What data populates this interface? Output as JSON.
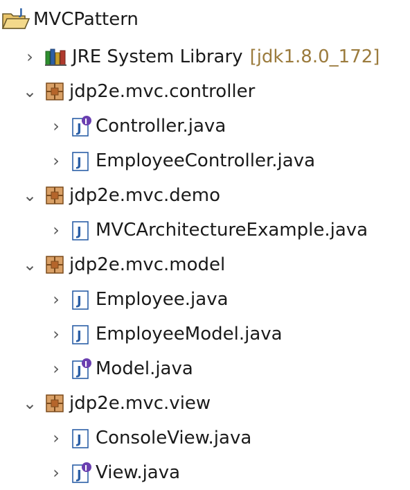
{
  "tree": {
    "project": {
      "label": "MVCPattern",
      "icon": "java-project-icon"
    },
    "jre": {
      "label": "JRE System Library",
      "decoration": "[jdk1.8.0_172]",
      "icon": "library-icon",
      "expanded": false
    },
    "packages": [
      {
        "label": "jdp2e.mvc.controller",
        "icon": "package-icon",
        "expanded": true,
        "files": [
          {
            "label": "Controller.java",
            "icon": "java-interface-icon"
          },
          {
            "label": "EmployeeController.java",
            "icon": "java-class-icon"
          }
        ]
      },
      {
        "label": "jdp2e.mvc.demo",
        "icon": "package-icon",
        "expanded": true,
        "files": [
          {
            "label": "MVCArchitectureExample.java",
            "icon": "java-class-icon"
          }
        ]
      },
      {
        "label": "jdp2e.mvc.model",
        "icon": "package-icon",
        "expanded": true,
        "files": [
          {
            "label": "Employee.java",
            "icon": "java-class-icon"
          },
          {
            "label": "EmployeeModel.java",
            "icon": "java-class-icon"
          },
          {
            "label": "Model.java",
            "icon": "java-interface-icon"
          }
        ]
      },
      {
        "label": "jdp2e.mvc.view",
        "icon": "package-icon",
        "expanded": true,
        "files": [
          {
            "label": "ConsoleView.java",
            "icon": "java-class-icon"
          },
          {
            "label": "View.java",
            "icon": "java-interface-icon"
          }
        ]
      }
    ],
    "colors": {
      "decoration": "#9b7b3d",
      "package": "#b5652b",
      "file_j": "#2b5fa6",
      "interface_badge": "#6a3fb0"
    }
  }
}
